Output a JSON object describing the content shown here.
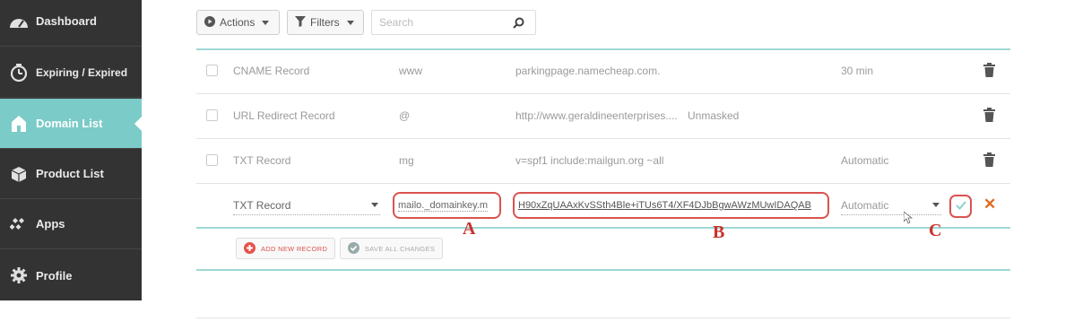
{
  "sidebar": {
    "items": [
      {
        "label": "Dashboard",
        "icon": "dashboard-icon"
      },
      {
        "label": "Expiring / Expired",
        "icon": "timer-icon"
      },
      {
        "label": "Domain List",
        "icon": "house-icon",
        "active": true
      },
      {
        "label": "Product List",
        "icon": "box-icon"
      },
      {
        "label": "Apps",
        "icon": "apps-icon"
      },
      {
        "label": "Profile",
        "icon": "gear-icon"
      }
    ]
  },
  "toolbar": {
    "actions_label": "Actions",
    "filters_label": "Filters",
    "search_placeholder": "Search"
  },
  "records": [
    {
      "type": "CNAME Record",
      "host": "www",
      "value": "parkingpage.namecheap.com.",
      "ttl": "30 min"
    },
    {
      "type": "URL Redirect Record",
      "host": "@",
      "value": "http://www.geraldineenterprises....",
      "extra": "Unmasked",
      "ttl": ""
    },
    {
      "type": "TXT Record",
      "host": "mg",
      "value": "v=spf1 include:mailgun.org ~all",
      "ttl": "Automatic"
    }
  ],
  "edit_row": {
    "type": "TXT Record",
    "host": "mailo._domainkey.m",
    "value": "H90xZqUAAxKvSSth4Ble+iTUs6T4/XF4DJbBgwAWzMUwIDAQAB",
    "ttl": "Automatic"
  },
  "actions": {
    "add_label": "ADD NEW RECORD",
    "save_all_label": "SAVE ALL CHANGES"
  },
  "callouts": {
    "a": "A",
    "b": "B",
    "c": "C"
  },
  "colors": {
    "sidebar_bg": "#333333",
    "active_teal": "#7bcbc8",
    "highlight_red": "#d9534f",
    "add_red": "#e8504a"
  }
}
